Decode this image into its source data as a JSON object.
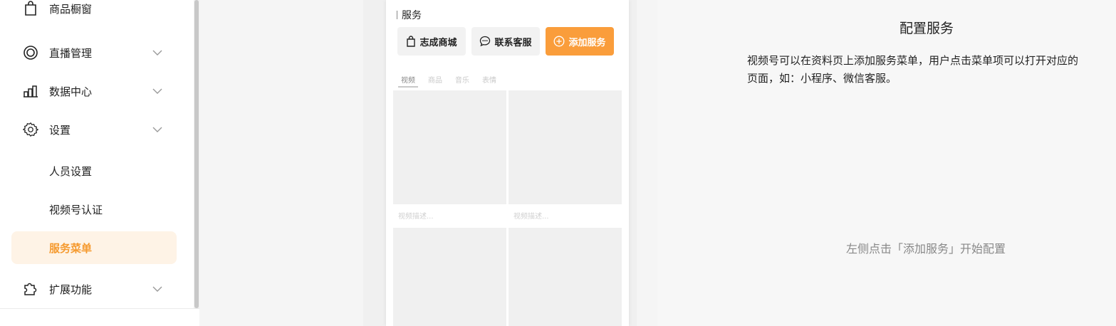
{
  "sidebar": {
    "items": [
      {
        "label": "商品橱窗",
        "icon": "shopping-bag-icon",
        "expandable": false
      },
      {
        "label": "直播管理",
        "icon": "live-broadcast-icon",
        "expandable": true
      },
      {
        "label": "数据中心",
        "icon": "bar-chart-icon",
        "expandable": true
      },
      {
        "label": "设置",
        "icon": "gear-icon",
        "expandable": true
      },
      {
        "label": "扩展功能",
        "icon": "puzzle-icon",
        "expandable": true
      }
    ],
    "settings_children": [
      {
        "label": "人员设置"
      },
      {
        "label": "视频号认证"
      },
      {
        "label": "服务菜单",
        "active": true
      }
    ]
  },
  "preview": {
    "section_title": "服务",
    "buttons": [
      {
        "label": "志成商城",
        "icon": "shopping-bag-icon"
      },
      {
        "label": "联系客服",
        "icon": "chat-bubble-icon"
      },
      {
        "label": "添加服务",
        "icon": "plus-circle-icon"
      }
    ],
    "tabs": [
      "视频",
      "商品",
      "音乐",
      "表情"
    ],
    "video_caption": "视频描述..."
  },
  "config": {
    "title": "配置服务",
    "description": "视频号可以在资料页上添加服务菜单，用户点击菜单项可以打开对应的页面，如：小程序、微信客服。",
    "hint": "左侧点击「添加服务」开始配置"
  },
  "colors": {
    "accent": "#fa9d3b",
    "active_bg": "#fef3e6",
    "active_text": "#f59a2f"
  }
}
